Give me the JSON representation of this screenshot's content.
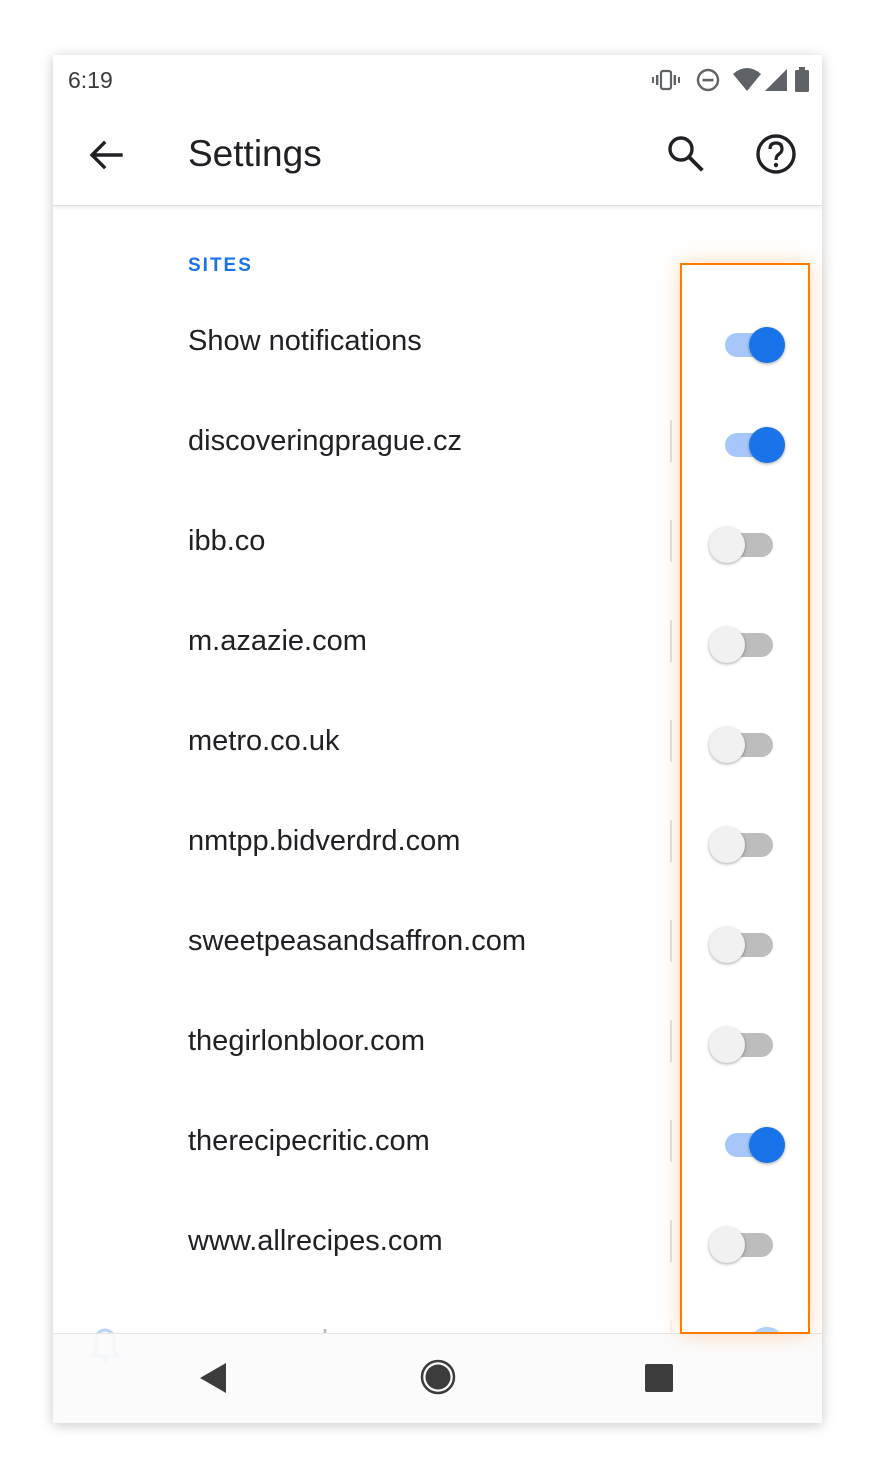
{
  "status_bar": {
    "time": "6:19",
    "icons": [
      "vibrate-icon",
      "do-not-disturb-icon",
      "wifi-icon",
      "cell-signal-icon",
      "battery-icon"
    ]
  },
  "app_bar": {
    "title": "Settings",
    "icons": [
      "back-arrow-icon",
      "search-icon",
      "help-icon"
    ]
  },
  "section": {
    "header": "SITES"
  },
  "master_toggle": {
    "label": "Show notifications",
    "enabled": true
  },
  "sites": [
    {
      "label": "discoveringprague.cz",
      "enabled": true
    },
    {
      "label": "ibb.co",
      "enabled": false
    },
    {
      "label": "m.azazie.com",
      "enabled": false
    },
    {
      "label": "metro.co.uk",
      "enabled": false
    },
    {
      "label": "nmtpp.bidverdrd.com",
      "enabled": false
    },
    {
      "label": "sweetpeasandsaffron.com",
      "enabled": false
    },
    {
      "label": "thegirlonbloor.com",
      "enabled": false
    },
    {
      "label": "therecipecritic.com",
      "enabled": true
    },
    {
      "label": "www.allrecipes.com",
      "enabled": false
    },
    {
      "label": "www.google.com",
      "enabled": true
    }
  ],
  "colors": {
    "accent": "#1a73e8",
    "toggle_on_track": "#a7c7fa",
    "toggle_off_thumb": "#f1f1f1",
    "highlight_border": "#ff7a00"
  },
  "nav_bar": {
    "icons": [
      "nav-back-icon",
      "nav-home-icon",
      "nav-recents-icon"
    ]
  }
}
